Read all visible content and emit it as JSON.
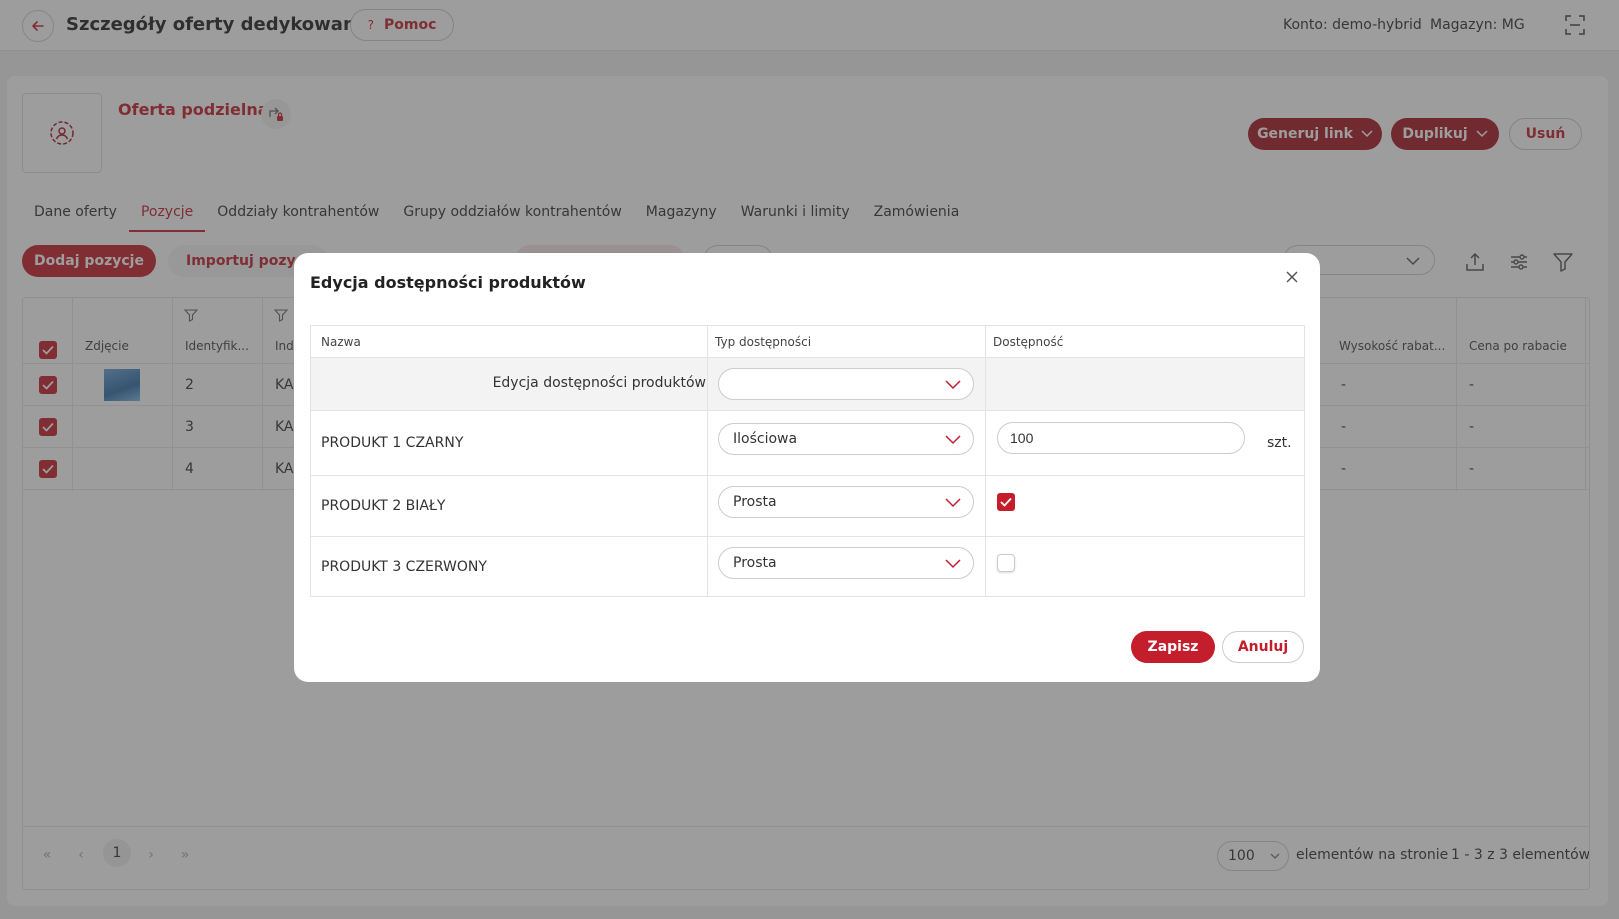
{
  "header": {
    "title": "Szczegóły oferty dedykowanej",
    "help_label": "Pomoc",
    "help_mark": "?",
    "account": "Konto: demo-hybrid",
    "warehouse": "Magazyn: MG"
  },
  "offer": {
    "name": "Oferta podzielna",
    "actions": {
      "generate_link": "Generuj link",
      "duplicate": "Duplikuj",
      "delete": "Usuń"
    }
  },
  "tabs": [
    {
      "label": "Dane oferty",
      "active": false
    },
    {
      "label": "Pozycje",
      "active": true
    },
    {
      "label": "Oddziały kontrahentów",
      "active": false
    },
    {
      "label": "Grupy oddziałów kontrahentów",
      "active": false
    },
    {
      "label": "Magazyny",
      "active": false
    },
    {
      "label": "Warunki i limity",
      "active": false
    },
    {
      "label": "Zamówienia",
      "active": false
    }
  ],
  "toolbar": {
    "add_positions": "Dodaj pozycje",
    "import_positions": "Importuj pozycje"
  },
  "background_table": {
    "columns": {
      "photo": "Zdjęcie",
      "identifier": "Identyfik...",
      "index": "Ind",
      "discount": "Wysokość rabat...",
      "price_after_discount": "Cena po rabacie"
    },
    "rows": [
      {
        "identifier": "2",
        "index": "KA",
        "discount": "-",
        "price": "-"
      },
      {
        "identifier": "3",
        "index": "KA",
        "discount": "-",
        "price": "-"
      },
      {
        "identifier": "4",
        "index": "KA",
        "discount": "-",
        "price": "-"
      }
    ]
  },
  "pagination": {
    "first": "«",
    "prev": "‹",
    "page": "1",
    "next": "›",
    "last": "»",
    "per_page": "100",
    "per_page_label": "elementów na stronie",
    "count_label": "1 - 3 z 3 elementów"
  },
  "modal": {
    "title": "Edycja dostępności produktów",
    "columns": {
      "name": "Nazwa",
      "type": "Typ dostępności",
      "availability": "Dostępność"
    },
    "bulk_row_label": "Edycja dostępności produktów",
    "bulk_select_value": "",
    "rows": [
      {
        "name": "PRODUKT 1 CZARNY",
        "type": "Ilościowa",
        "quantity": "100",
        "unit": "szt."
      },
      {
        "name": "PRODUKT 2 BIAŁY",
        "type": "Prosta",
        "checked": true
      },
      {
        "name": "PRODUKT 3 CZERWONY",
        "type": "Prosta",
        "checked": false
      }
    ],
    "save_label": "Zapisz",
    "cancel_label": "Anuluj"
  },
  "colors": {
    "accent": "#c41e2d",
    "accent_dark": "#a71925"
  }
}
